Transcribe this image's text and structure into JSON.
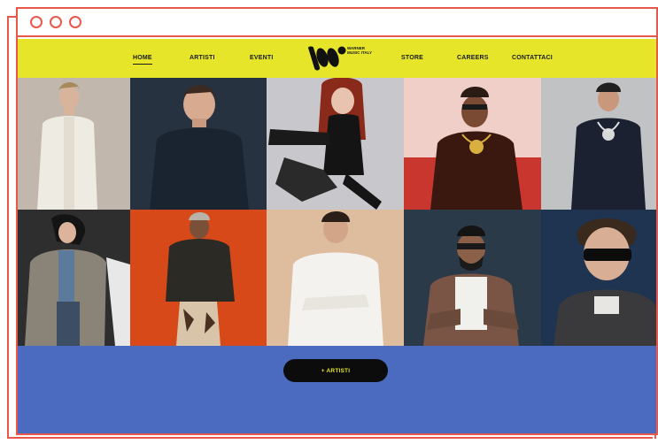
{
  "nav": {
    "items": [
      {
        "label": "HOME",
        "active": true
      },
      {
        "label": "ARTISTI",
        "active": false
      },
      {
        "label": "EVENTI",
        "active": false
      },
      {
        "label": "STORE",
        "active": false
      },
      {
        "label": "CAREERS",
        "active": false
      },
      {
        "label": "CONTATTACI",
        "active": false
      }
    ],
    "logo_text": "WARNER MUSIC ITALY"
  },
  "artists_grid": {
    "rows": 2,
    "columns": 5
  },
  "cta": {
    "label": "+ ARTISTI"
  },
  "colors": {
    "accent_yellow": "#e6e52a",
    "frame_red": "#e8584a",
    "band_blue": "#4a6bc0",
    "button_black": "#0c0c0c"
  }
}
